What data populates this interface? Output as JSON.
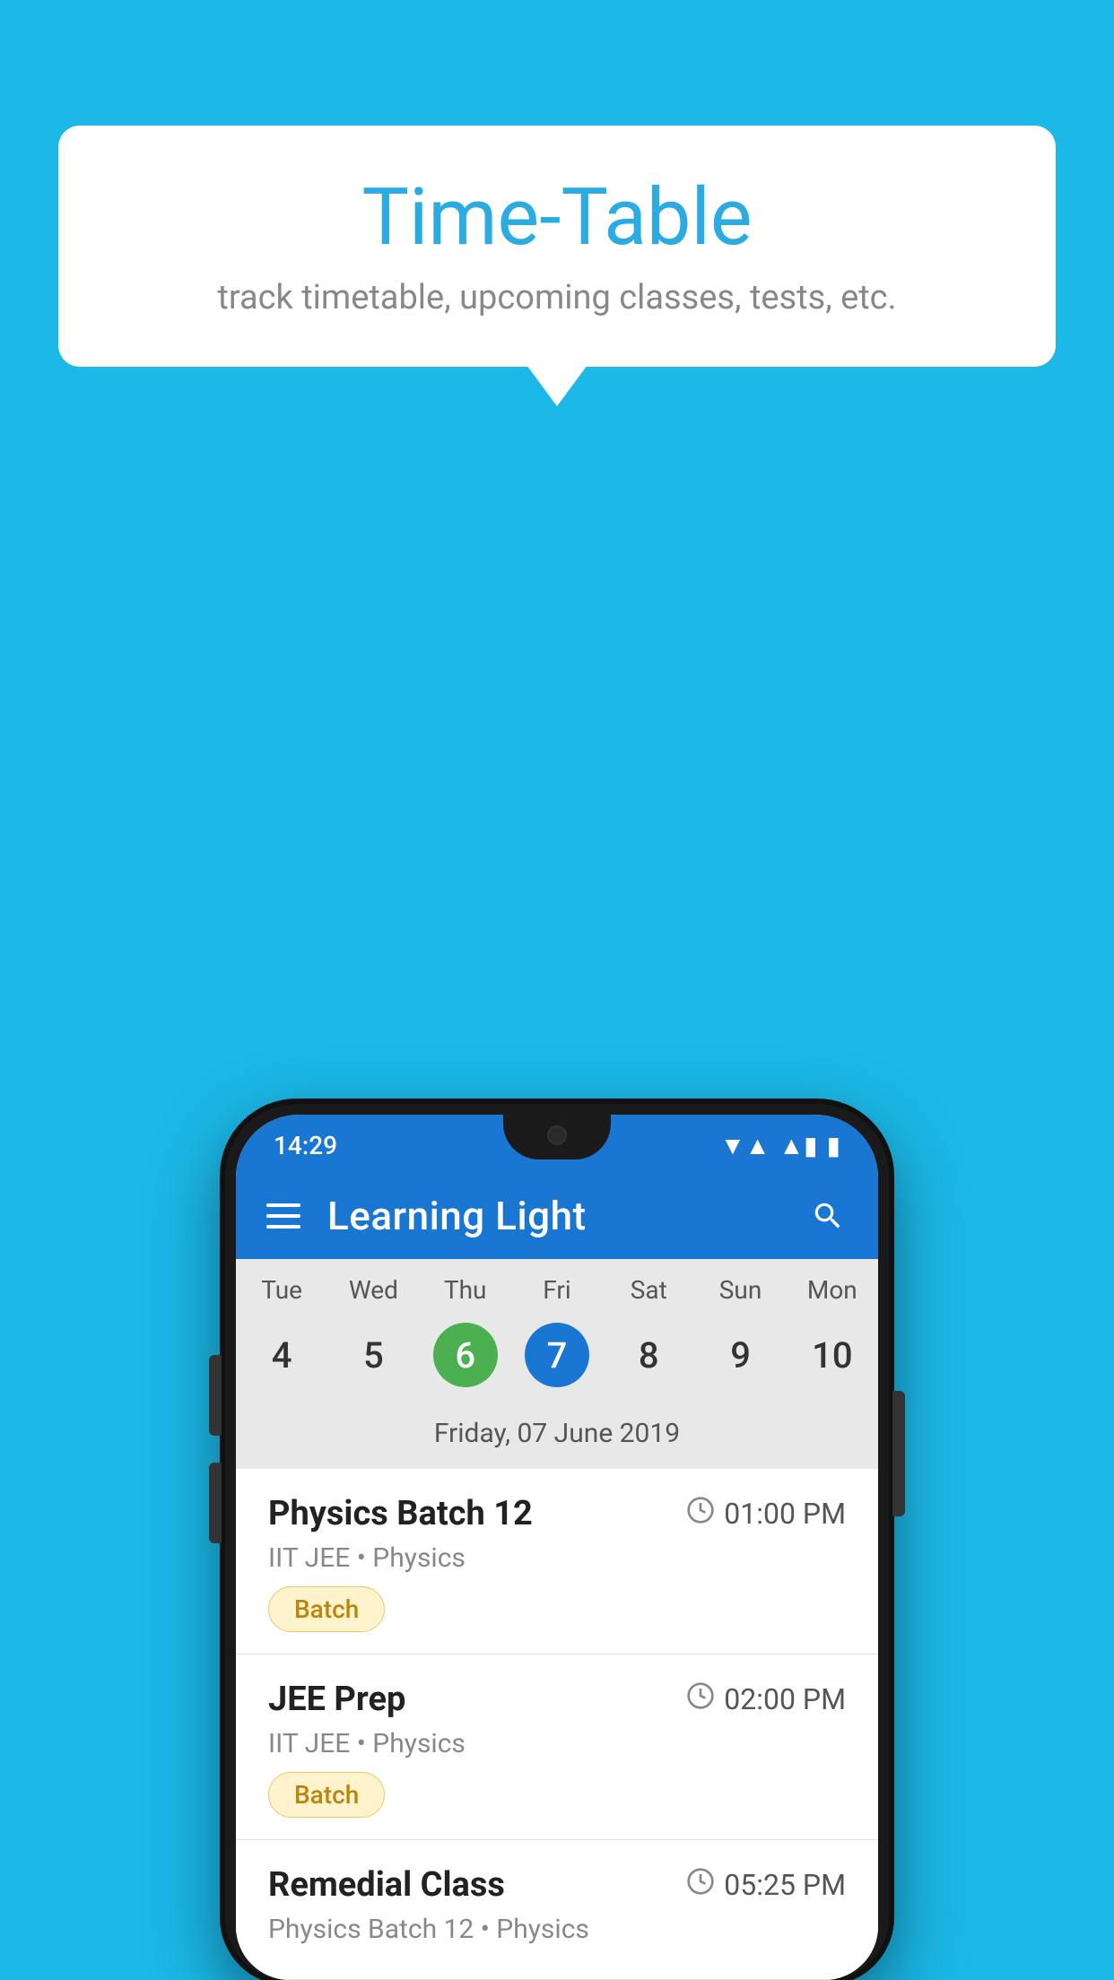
{
  "background_color": "#1BB8E8",
  "speech_bubble": {
    "title": "Time-Table",
    "subtitle": "track timetable, upcoming classes, tests, etc."
  },
  "phone": {
    "status_bar": {
      "time": "14:29",
      "wifi": "▼▲",
      "battery": "▮"
    },
    "app_bar": {
      "title": "Learning Light",
      "menu_icon_label": "menu",
      "search_icon_label": "search"
    },
    "calendar": {
      "day_headers": [
        "Tue",
        "Wed",
        "Thu",
        "Fri",
        "Sat",
        "Sun",
        "Mon"
      ],
      "day_numbers": [
        "4",
        "5",
        "6",
        "7",
        "8",
        "9",
        "10"
      ],
      "today_index": 2,
      "selected_index": 3,
      "selected_date": "Friday, 07 June 2019"
    },
    "schedule": [
      {
        "title": "Physics Batch 12",
        "time": "01:00 PM",
        "subtitle": "IIT JEE • Physics",
        "tag": "Batch"
      },
      {
        "title": "JEE Prep",
        "time": "02:00 PM",
        "subtitle": "IIT JEE • Physics",
        "tag": "Batch"
      },
      {
        "title": "Remedial Class",
        "time": "05:25 PM",
        "subtitle": "Physics Batch 12 • Physics",
        "tag": ""
      }
    ]
  }
}
